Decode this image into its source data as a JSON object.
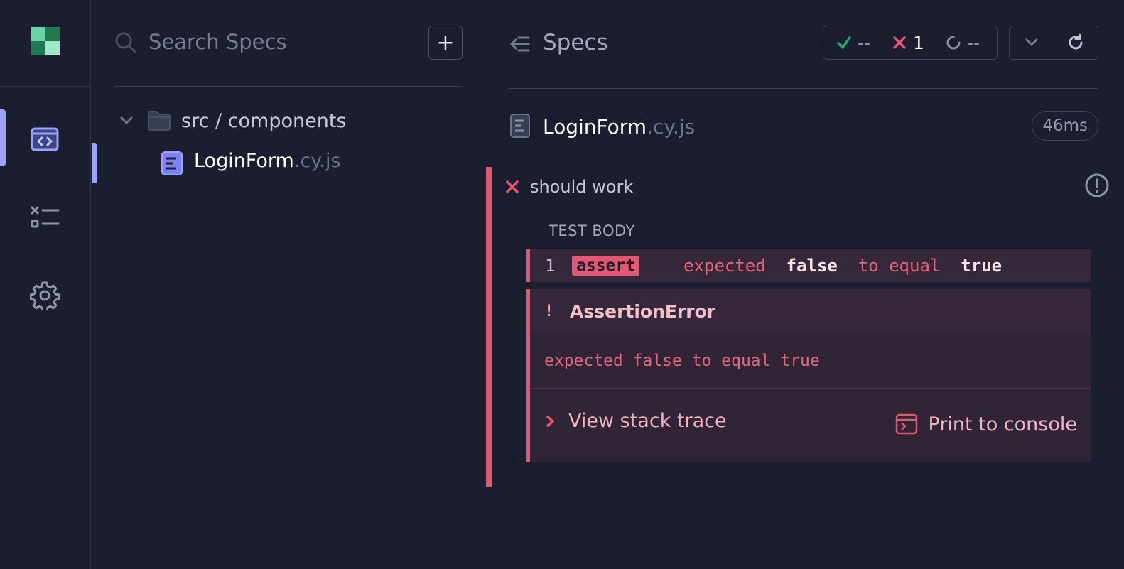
{
  "nav": {
    "items": [
      {
        "name": "specs",
        "icon": "code-window-icon",
        "active": true
      },
      {
        "name": "runs",
        "icon": "list-check-icon",
        "active": false
      },
      {
        "name": "settings",
        "icon": "gear-icon",
        "active": false
      }
    ]
  },
  "specs_panel": {
    "search_placeholder": "Search Specs",
    "add_label": "+",
    "folder_label": "src / components",
    "file": {
      "name": "LoginForm",
      "ext": ".cy.js"
    }
  },
  "reporter": {
    "title": "Specs",
    "stats": {
      "passed": "--",
      "failed": "1",
      "pending": "--"
    },
    "spec": {
      "name": "LoginForm",
      "ext": ".cy.js",
      "duration": "46ms"
    },
    "test": {
      "title": "should work",
      "body_label": "TEST BODY",
      "command": {
        "number": "1",
        "name": "assert",
        "msg_a": "expected",
        "msg_b": "false",
        "msg_c": "to equal",
        "msg_d": "true"
      },
      "error": {
        "bang": "!",
        "name": "AssertionError",
        "message": "expected false to equal true",
        "stack_label": "View stack trace",
        "print_label": "Print to console"
      }
    }
  },
  "colors": {
    "background": "#1b1e2e",
    "accent": "#9aa2fc",
    "fail": "#e45770",
    "pass": "#1fa971"
  }
}
